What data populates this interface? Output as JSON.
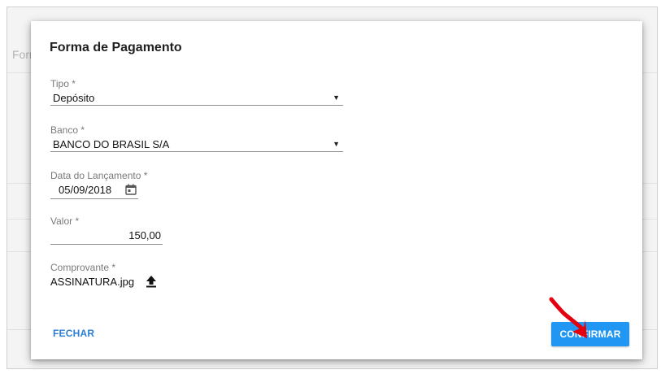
{
  "background": {
    "section_label": "Form"
  },
  "modal": {
    "title": "Forma de Pagamento",
    "fields": {
      "tipo": {
        "label": "Tipo *",
        "value": "Depósito"
      },
      "banco": {
        "label": "Banco *",
        "value": "BANCO DO BRASIL S/A"
      },
      "data": {
        "label": "Data do Lançamento *",
        "value": "05/09/2018"
      },
      "valor": {
        "label": "Valor *",
        "value": "150,00"
      },
      "comprovante": {
        "label": "Comprovante *",
        "value": "ASSINATURA.jpg"
      }
    },
    "buttons": {
      "fechar": "FECHAR",
      "confirmar": "CONFIRMAR"
    }
  },
  "colors": {
    "primary": "#2196f3",
    "link": "#2b7ed6",
    "annotation_arrow": "#e3000f"
  },
  "icons": {
    "dropdown": "caret-down-icon",
    "calendar": "calendar-icon",
    "upload": "upload-icon",
    "annotation": "red-arrow-icon"
  }
}
